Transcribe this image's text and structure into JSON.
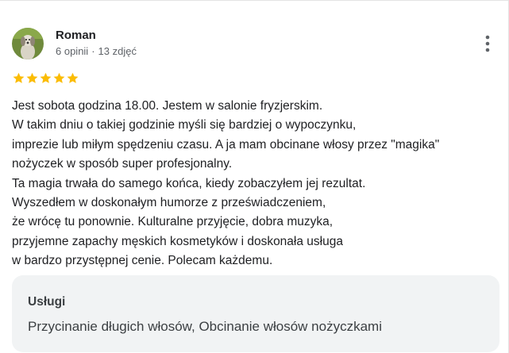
{
  "reviewer": {
    "name": "Roman",
    "reviews_count": "6 opinii",
    "separator": "·",
    "photos_count": "13 zdjęć"
  },
  "rating": {
    "stars": 5,
    "max": 5,
    "color": "#fbbc04"
  },
  "review": {
    "text": "Jest sobota godzina 18.00. Jestem w salonie fryzjerskim.\nW takim dniu o takiej godzinie myśli się bardziej o wypoczynku,\nimprezie lub miłym spędzeniu czasu. A ja mam obcinane włosy przez \"magika\"\nnożyczek w sposób super profesjonalny.\nTa magia trwała do samego końca, kiedy zobaczyłem jej rezultat.\nWyszedłem w doskonałym humorze z przeświadczeniem,\nże wrócę tu ponownie. Kulturalne przyjęcie, dobra muzyka,\nprzyjemne zapachy męskich kosmetyków i doskonała usługa\nw bardzo przystępnej cenie. Polecam każdemu."
  },
  "services": {
    "title": "Usługi",
    "list": "Przycinanie długich włosów, Obcinanie włosów nożyczkami"
  },
  "icons": {
    "more": "more-vert-icon",
    "star": "star-icon"
  }
}
